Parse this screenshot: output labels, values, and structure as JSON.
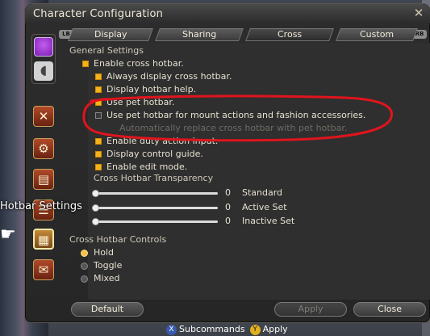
{
  "window": {
    "title": "Character Configuration",
    "lb": "LB",
    "rb": "RB"
  },
  "tabs": [
    {
      "label": "Display"
    },
    {
      "label": "Sharing"
    },
    {
      "label": "Cross"
    },
    {
      "label": "Custom"
    }
  ],
  "sidebar": {
    "hover_label": "Hotbar Settings"
  },
  "general": {
    "section_title": "General Settings",
    "items": [
      {
        "label": "Enable cross hotbar.",
        "checked": true
      },
      {
        "label": "Always display cross hotbar.",
        "checked": true
      },
      {
        "label": "Display hotbar help.",
        "checked": true
      },
      {
        "label": "Use pet hotbar.",
        "checked": true
      },
      {
        "label": "Use pet hotbar for mount actions and fashion accessories.",
        "checked": false
      },
      {
        "label": "Automatically replace cross hotbar with pet hotbar.",
        "checked": false,
        "disabled": true
      },
      {
        "label": "Enable duty action input.",
        "checked": true
      },
      {
        "label": "Display control guide.",
        "checked": true
      },
      {
        "label": "Enable edit mode.",
        "checked": true
      }
    ]
  },
  "transparency": {
    "section_title": "Cross Hotbar Transparency",
    "sliders": [
      {
        "label": "Standard",
        "value": "0"
      },
      {
        "label": "Active Set",
        "value": "0"
      },
      {
        "label": "Inactive Set",
        "value": "0"
      }
    ]
  },
  "controls": {
    "section_title": "Cross Hotbar Controls",
    "options": [
      {
        "label": "Hold",
        "selected": true
      },
      {
        "label": "Toggle",
        "selected": false
      },
      {
        "label": "Mixed",
        "selected": false
      }
    ]
  },
  "footer": {
    "default_label": "Default",
    "apply_label": "Apply",
    "close_label": "Close"
  },
  "hints": {
    "x_glyph": "X",
    "subcommands": "Subcommands",
    "y_glyph": "Y",
    "apply": "Apply"
  },
  "colors": {
    "checkbox_on": "#f3b31c",
    "annotation": "#e0141c"
  }
}
